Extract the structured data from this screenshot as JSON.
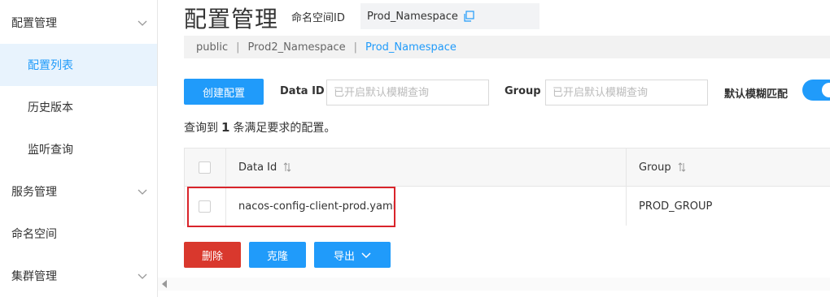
{
  "sidebar": {
    "items": [
      {
        "label": "配置管理",
        "type": "group"
      },
      {
        "label": "配置列表",
        "type": "sub",
        "active": true
      },
      {
        "label": "历史版本",
        "type": "sub"
      },
      {
        "label": "监听查询",
        "type": "sub"
      },
      {
        "label": "服务管理",
        "type": "group"
      },
      {
        "label": "命名空间",
        "type": "item"
      },
      {
        "label": "集群管理",
        "type": "group"
      }
    ]
  },
  "header": {
    "title": "配置管理",
    "namespace_label": "命名空间ID",
    "namespace_value": "Prod_Namespace"
  },
  "namespaces": {
    "items": [
      "public",
      "Prod2_Namespace",
      "Prod_Namespace"
    ],
    "separator": "|",
    "current": "Prod_Namespace"
  },
  "toolbar": {
    "create_label": "创建配置",
    "data_id_label": "Data ID",
    "data_id_placeholder": "已开启默认模糊查询",
    "group_label": "Group",
    "group_placeholder": "已开启默认模糊查询",
    "fuzzy_label": "默认模糊匹配",
    "fuzzy_enabled": true
  },
  "summary": {
    "prefix": "查询到",
    "count": "1",
    "suffix": "条满足要求的配置。"
  },
  "table": {
    "columns": [
      "Data Id",
      "Group"
    ],
    "rows": [
      {
        "data_id": "nacos-config-client-prod.yaml",
        "group": "PROD_GROUP"
      }
    ]
  },
  "actions": {
    "delete_label": "删除",
    "clone_label": "克隆",
    "export_label": "导出"
  },
  "colors": {
    "primary": "#209bfa",
    "danger": "#d9382d",
    "highlight": "#d9242b"
  }
}
